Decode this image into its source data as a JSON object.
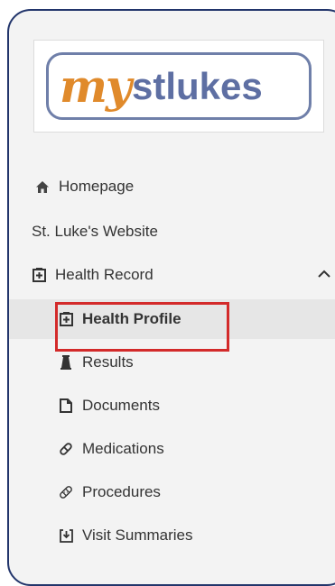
{
  "logo": {
    "part1": "my",
    "part2": "stlukes"
  },
  "nav": {
    "homepage": "Homepage",
    "website": "St. Luke's Website",
    "health_record": "Health Record",
    "health_profile": "Health Profile",
    "results": "Results",
    "documents": "Documents",
    "medications": "Medications",
    "procedures": "Procedures",
    "visit_summaries": "Visit Summaries"
  },
  "colors": {
    "frame_border": "#22356b",
    "logo_orange": "#e08a2b",
    "logo_blue": "#5e6fa3",
    "highlight_red": "#d32a2a",
    "selected_bg": "#e6e6e6"
  },
  "icons": {
    "homepage": "home-icon",
    "health_record": "medical-record-icon",
    "health_record_toggle": "chevron-up-icon",
    "health_profile": "medical-record-icon",
    "results": "flask-icon",
    "documents": "document-icon",
    "medications": "pill-icon",
    "procedures": "bandage-icon",
    "visit_summaries": "download-box-icon"
  }
}
